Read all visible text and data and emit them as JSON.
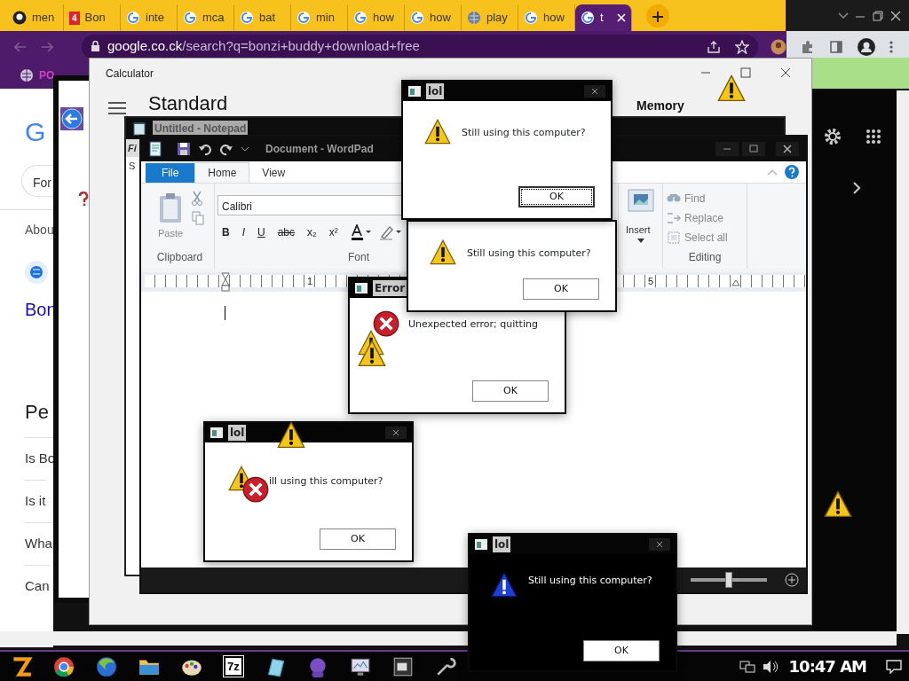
{
  "browser": {
    "tabs": [
      {
        "label": "men",
        "kind": "github",
        "selected": false
      },
      {
        "label": "Bon",
        "kind": "badge",
        "badge": "4",
        "selected": false
      },
      {
        "label": "inte",
        "kind": "google",
        "selected": false
      },
      {
        "label": "mca",
        "kind": "google",
        "selected": false
      },
      {
        "label": "bat",
        "kind": "google",
        "selected": false
      },
      {
        "label": "min",
        "kind": "google",
        "selected": false
      },
      {
        "label": "how",
        "kind": "google",
        "selected": false
      },
      {
        "label": "how",
        "kind": "google",
        "selected": false
      },
      {
        "label": "play",
        "kind": "globe",
        "selected": false
      },
      {
        "label": "how",
        "kind": "google",
        "selected": false
      },
      {
        "label": "t",
        "kind": "google",
        "selected": true
      }
    ],
    "url_host": "google.co.ck",
    "url_path": "/search?q=bonzi+buddy+download+free",
    "bookmark": "PO",
    "page": {
      "logo": "G",
      "chip": "For",
      "about": "Abou",
      "result_title": "Bon",
      "section": "Pe",
      "questions": [
        "Is Bo",
        "Is it",
        "Wha",
        "Can"
      ]
    }
  },
  "calculator": {
    "title": "Calculator",
    "mode": "Standard",
    "memory": "Memory"
  },
  "notepad": {
    "title": "Untitled - Notepad",
    "menu": "Fi",
    "line": "S"
  },
  "wordpad": {
    "title": "Document - WordPad",
    "tabs": [
      {
        "label": "File",
        "kind": "file",
        "selected": false
      },
      {
        "label": "Home",
        "kind": "tab",
        "selected": true
      },
      {
        "label": "View",
        "kind": "tab",
        "selected": false
      }
    ],
    "paste": "Paste",
    "clipboard": "Clipboard",
    "font_name": "Calibri",
    "format_buttons": [
      "B",
      "I",
      "U",
      "abc",
      "x₂",
      "x²"
    ],
    "font_label": "Font",
    "insert": "Insert",
    "editing": [
      "Find",
      "Replace",
      "Select all"
    ],
    "editing_label": "Editing",
    "ruler": [
      "1",
      "5"
    ],
    "zoom": {
      "level": 0.5
    }
  },
  "dialogs": [
    {
      "kind": "warning",
      "title": "lol",
      "message": "Still using this computer?",
      "button": "OK",
      "focused": true
    },
    {
      "kind": "warning",
      "message": "Still using this computer?",
      "button": "OK",
      "focused": false
    },
    {
      "kind": "error",
      "title": "Error",
      "message": "Unexpected error; quitting",
      "button": "OK",
      "focused": false
    },
    {
      "kind": "stacked",
      "title": "lol",
      "message": "ill using this computer?",
      "button": "OK",
      "focused": false
    },
    {
      "kind": "dark",
      "title": "lol",
      "message": "Still using this computer?",
      "button": "OK",
      "focused": false
    }
  ],
  "taskbar": {
    "archiver_label": "7z",
    "clock": "10:47 AM"
  }
}
